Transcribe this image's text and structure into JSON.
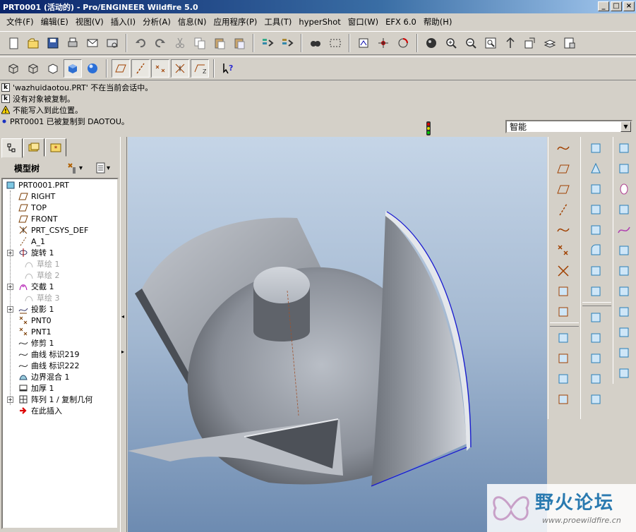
{
  "window": {
    "title": "PRT0001 (活动的) - Pro/ENGINEER Wildfire 5.0"
  },
  "menu": [
    "文件(F)",
    "编辑(E)",
    "视图(V)",
    "插入(I)",
    "分析(A)",
    "信息(N)",
    "应用程序(P)",
    "工具(T)",
    "hyperShot",
    "窗口(W)",
    "EFX 6.0",
    "帮助(H)"
  ],
  "toolbar_row1_icons": [
    "new-icon",
    "open-icon",
    "save-icon",
    "print-icon",
    "email-icon",
    "email-link-icon",
    "undo-icon",
    "redo-icon",
    "cut-icon",
    "copy-icon",
    "paste-icon",
    "paste-special-icon",
    "regenerate-icon",
    "regenerate-manager-icon",
    "find-icon",
    "select-box-icon",
    "repaint-icon",
    "spin-center-icon",
    "orient-icon",
    "appearance-icon",
    "zoom-in-icon",
    "zoom-out-icon",
    "refit-icon",
    "reorient-icon",
    "saved-views-icon",
    "layers-icon",
    "view-manager-icon"
  ],
  "toolbar_row2_icons": [
    "wireframe-icon",
    "hidden-line-icon",
    "no-hidden-icon",
    "shading-icon",
    "enhanced-realism-icon",
    "datum-plane-display-icon",
    "datum-axis-display-icon",
    "point-display-icon",
    "csys-display-icon",
    "annotation-display-icon",
    "context-help-icon"
  ],
  "messages": [
    {
      "icon": "k",
      "text": "'wazhuidaotou.PRT' 不在当前会话中。"
    },
    {
      "icon": "k",
      "text": "没有对象被复制。"
    },
    {
      "icon": "w",
      "text": "不能写入到此位置。"
    },
    {
      "icon": "dot",
      "text": "PRT0001 已被复制到 DAOTOU。"
    }
  ],
  "filter": {
    "value": "智能"
  },
  "panel": {
    "title": "模型树",
    "tree": [
      {
        "label": "PRT0001.PRT",
        "icon": "part-icon",
        "expand": false,
        "dim": false
      },
      {
        "label": "RIGHT",
        "icon": "datum-plane-icon",
        "expand": false,
        "dim": false
      },
      {
        "label": "TOP",
        "icon": "datum-plane-icon",
        "expand": false,
        "dim": false
      },
      {
        "label": "FRONT",
        "icon": "datum-plane-icon",
        "expand": false,
        "dim": false
      },
      {
        "label": "PRT_CSYS_DEF",
        "icon": "csys-icon",
        "expand": false,
        "dim": false
      },
      {
        "label": "A_1",
        "icon": "axis-icon",
        "expand": false,
        "dim": false
      },
      {
        "label": "旋转 1",
        "icon": "revolve-icon",
        "expand": true,
        "dim": false
      },
      {
        "label": "草绘 1",
        "icon": "sketch-icon",
        "expand": false,
        "dim": true
      },
      {
        "label": "草绘 2",
        "icon": "sketch-icon",
        "expand": false,
        "dim": true
      },
      {
        "label": "交截 1",
        "icon": "intersect-icon",
        "expand": true,
        "dim": false
      },
      {
        "label": "草绘 3",
        "icon": "sketch-icon",
        "expand": false,
        "dim": true
      },
      {
        "label": "投影 1",
        "icon": "project-icon",
        "expand": true,
        "dim": false
      },
      {
        "label": "PNT0",
        "icon": "point-icon",
        "expand": false,
        "dim": false
      },
      {
        "label": "PNT1",
        "icon": "point-icon",
        "expand": false,
        "dim": false
      },
      {
        "label": "修剪 1",
        "icon": "trim-icon",
        "expand": false,
        "dim": false
      },
      {
        "label": "曲线 标识219",
        "icon": "curve-icon",
        "expand": false,
        "dim": false
      },
      {
        "label": "曲线 标识222",
        "icon": "curve-icon",
        "expand": false,
        "dim": false
      },
      {
        "label": "边界混合 1",
        "icon": "boundary-blend-icon",
        "expand": false,
        "dim": false
      },
      {
        "label": "加厚 1",
        "icon": "thicken-icon",
        "expand": false,
        "dim": false
      },
      {
        "label": "阵列 1 / 复制几何",
        "icon": "pattern-icon",
        "expand": true,
        "dim": false
      },
      {
        "label": "在此插入",
        "icon": "insert-here-icon",
        "expand": false,
        "dim": false
      }
    ]
  },
  "right_toolbar_1": [
    "sketch-datum-curve-icon",
    "datum-plane-icon",
    "datum-plane-offset-icon",
    "datum-axis-icon",
    "datum-curve-icon",
    "datum-point-icon",
    "csys-icon",
    "analysis-feature-icon",
    "insert-feature-icon"
  ],
  "right_toolbar_1b": [
    "sketch-tool-icon",
    "sketched-datum-icon",
    "cosmetic-icon",
    "insert-udf-icon"
  ],
  "right_toolbar_2": [
    "extrude-icon",
    "revolve-tool-icon",
    "sweep-icon",
    "shell-icon",
    "draft-icon",
    "round-icon",
    "chamfer-icon",
    "rib-icon"
  ],
  "right_toolbar_2b": [
    "mirror-icon",
    "merge-icon",
    "trim-tool-icon",
    "extend-icon",
    "offset-icon"
  ],
  "right_toolbar_3": [
    "pattern-tool-icon",
    "copy-geom-icon",
    "hole-icon",
    "shell-solid-icon",
    "style-icon",
    "thicken-tool-icon",
    "solidify-icon",
    "warp-icon",
    "toggle-grid-icon",
    "grid-icon",
    "grid-alt-icon",
    "publish-geom-icon"
  ],
  "watermark": {
    "text": "野火论坛",
    "url": "www.proewildfire.cn"
  },
  "colors": {
    "title_start": "#0a246a",
    "title_end": "#a6caf0",
    "viewport_top": "#c5d5e7",
    "viewport_bottom": "#6d8bb1",
    "model": "#9aa0a8",
    "edge_highlight": "#1a1ad0"
  }
}
